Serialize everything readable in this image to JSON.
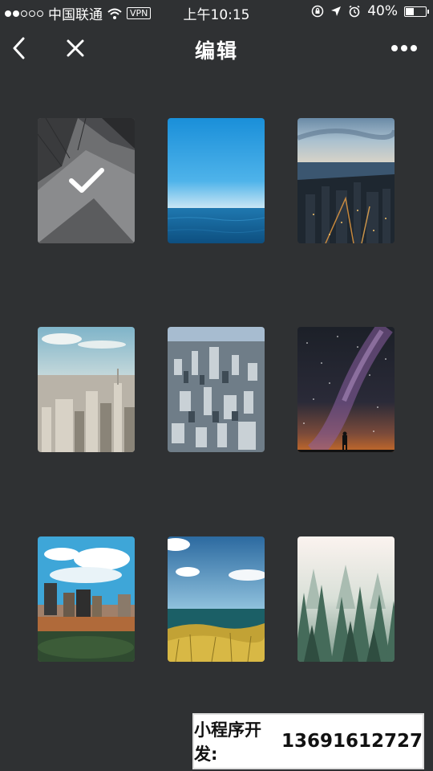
{
  "status_bar": {
    "carrier": "中国联通",
    "vpn": "VPN",
    "time": "上午10:15",
    "battery_text": "40%",
    "battery_level": 0.4,
    "signal_filled": 2,
    "signal_total": 5
  },
  "nav": {
    "title": "编辑",
    "back_icon": "back-chevron-icon",
    "close_icon": "close-icon",
    "more_icon": "more-dots-icon"
  },
  "gallery": {
    "selected_index": 0,
    "items": [
      {
        "name": "architecture-photo",
        "selected": true
      },
      {
        "name": "ocean-sky-photo",
        "selected": false
      },
      {
        "name": "city-night-coast-photo",
        "selected": false
      },
      {
        "name": "manhattan-skyline-photo",
        "selected": false
      },
      {
        "name": "city-aerial-photo",
        "selected": false
      },
      {
        "name": "milky-way-photo",
        "selected": false
      },
      {
        "name": "city-clouds-photo",
        "selected": false
      },
      {
        "name": "beach-grass-photo",
        "selected": false
      },
      {
        "name": "misty-forest-photo",
        "selected": false
      }
    ]
  },
  "banner": {
    "label": "小程序开发:",
    "phone": "13691612727"
  },
  "colors": {
    "background": "#2f3133",
    "text": "#ffffff"
  }
}
